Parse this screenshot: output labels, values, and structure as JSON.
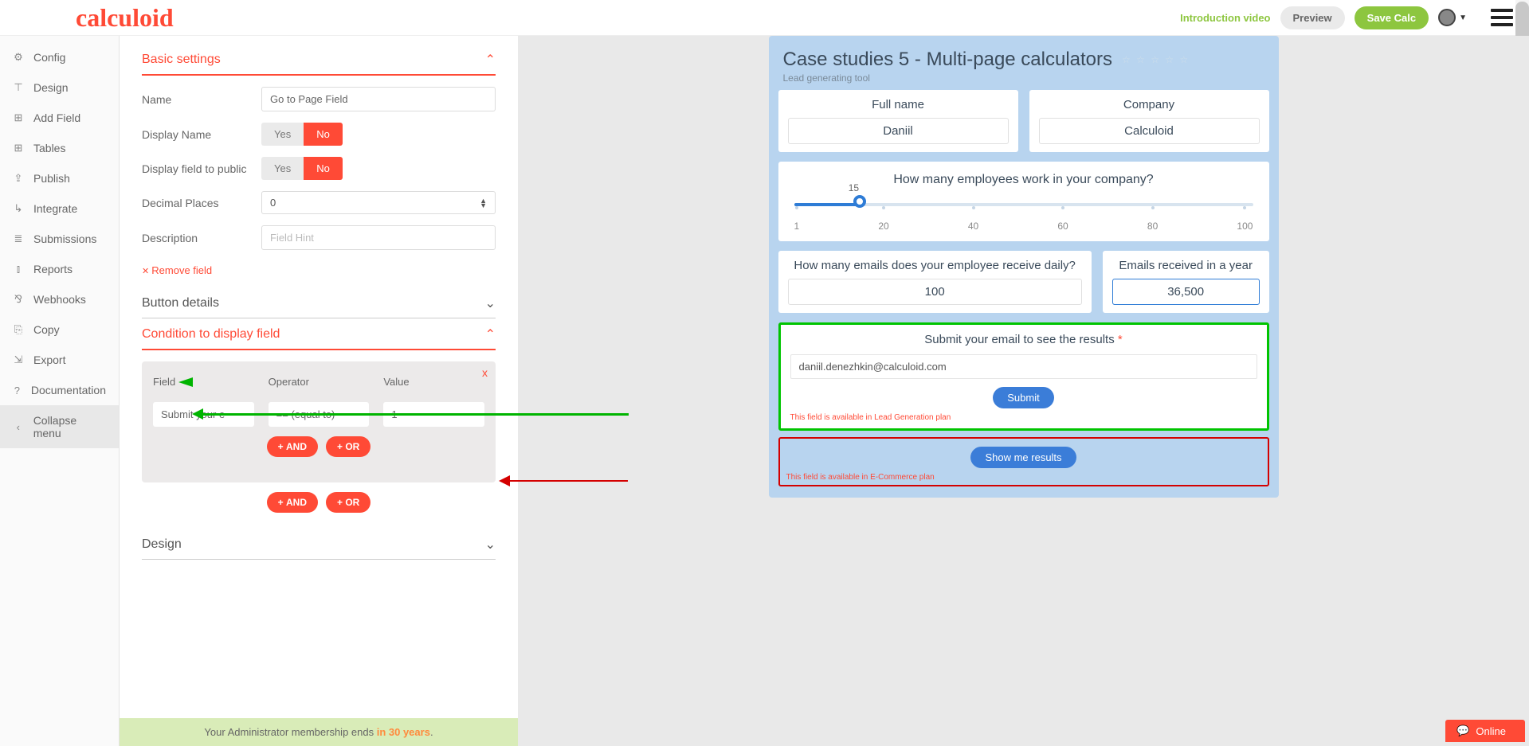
{
  "topbar": {
    "logo": "calculoid",
    "intro": "Introduction video",
    "preview": "Preview",
    "save": "Save Calc"
  },
  "sidebar": {
    "items": [
      {
        "icon": "⚙",
        "label": "Config"
      },
      {
        "icon": "⊤",
        "label": "Design"
      },
      {
        "icon": "⊞",
        "label": "Add Field"
      },
      {
        "icon": "⊞",
        "label": "Tables"
      },
      {
        "icon": "⇪",
        "label": "Publish"
      },
      {
        "icon": "↳",
        "label": "Integrate"
      },
      {
        "icon": "≣",
        "label": "Submissions"
      },
      {
        "icon": "⫾",
        "label": "Reports"
      },
      {
        "icon": "⅋",
        "label": "Webhooks"
      },
      {
        "icon": "⎘",
        "label": "Copy"
      },
      {
        "icon": "⇲",
        "label": "Export"
      },
      {
        "icon": "?",
        "label": "Documentation"
      },
      {
        "icon": "‹",
        "label": "Collapse menu"
      }
    ]
  },
  "editor": {
    "basic_title": "Basic settings",
    "name_label": "Name",
    "name_value": "Go to Page Field",
    "display_name_label": "Display Name",
    "display_public_label": "Display field to public",
    "yes": "Yes",
    "no": "No",
    "decimal_label": "Decimal Places",
    "decimal_value": "0",
    "desc_label": "Description",
    "desc_placeholder": "Field Hint",
    "remove": "Remove field",
    "button_details": "Button details",
    "condition_title": "Condition to display field",
    "cond_close": "x",
    "cond_field": "Field",
    "cond_operator": "Operator",
    "cond_value": "Value",
    "cond_field_val": "Submit your e",
    "cond_op_val": "== (equal to)",
    "cond_val_val": "1",
    "and": "AND",
    "or": "OR",
    "design": "Design"
  },
  "calc": {
    "title": "Case studies 5 - Multi-page calculators",
    "subtitle": "Lead generating tool",
    "fullname_label": "Full name",
    "fullname_val": "Daniil",
    "company_label": "Company",
    "company_val": "Calculoid",
    "slider_q": "How many employees work in your company?",
    "slider_val": "15",
    "ticks": [
      "1",
      "20",
      "40",
      "60",
      "80",
      "100"
    ],
    "emails_q": "How many emails does your employee receive daily?",
    "emails_val": "100",
    "year_label": "Emails received in a year",
    "year_val": "36,500",
    "submit_title": "Submit your email to see the results ",
    "submit_star": "*",
    "submit_email": "daniil.denezhkin@calculoid.com",
    "submit_btn": "Submit",
    "submit_note": "This field is available in Lead Generation plan",
    "results_btn": "Show me results",
    "results_note": "This field is available in E-Commerce plan"
  },
  "footer": {
    "text": "Your Administrator membership ends ",
    "years": "in 30 years"
  },
  "online": "Online"
}
